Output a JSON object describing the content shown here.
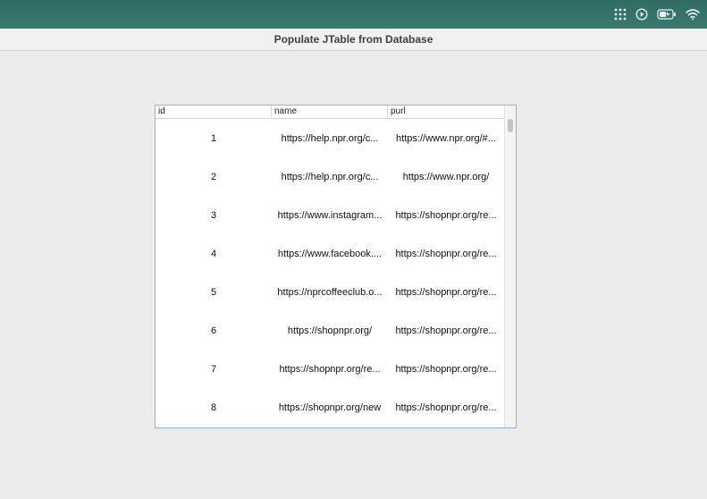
{
  "menubar": {
    "icons": [
      "control-center-icon",
      "play-circle-icon",
      "battery-icon",
      "wifi-icon"
    ]
  },
  "window": {
    "title": "Populate JTable from Database"
  },
  "table": {
    "columns": [
      "id",
      "name",
      "purl"
    ],
    "rows": [
      {
        "id": "1",
        "name": "https://help.npr.org/c...",
        "purl": "https://www.npr.org/#..."
      },
      {
        "id": "2",
        "name": "https://help.npr.org/c...",
        "purl": "https://www.npr.org/"
      },
      {
        "id": "3",
        "name": "https://www.instagram...",
        "purl": "https://shopnpr.org/re..."
      },
      {
        "id": "4",
        "name": "https://www.facebook....",
        "purl": "https://shopnpr.org/re..."
      },
      {
        "id": "5",
        "name": "https://nprcoffeeclub.o...",
        "purl": "https://shopnpr.org/re..."
      },
      {
        "id": "6",
        "name": "https://shopnpr.org/",
        "purl": "https://shopnpr.org/re..."
      },
      {
        "id": "7",
        "name": "https://shopnpr.org/re...",
        "purl": "https://shopnpr.org/re..."
      },
      {
        "id": "8",
        "name": "https://shopnpr.org/new",
        "purl": "https://shopnpr.org/re..."
      }
    ]
  }
}
